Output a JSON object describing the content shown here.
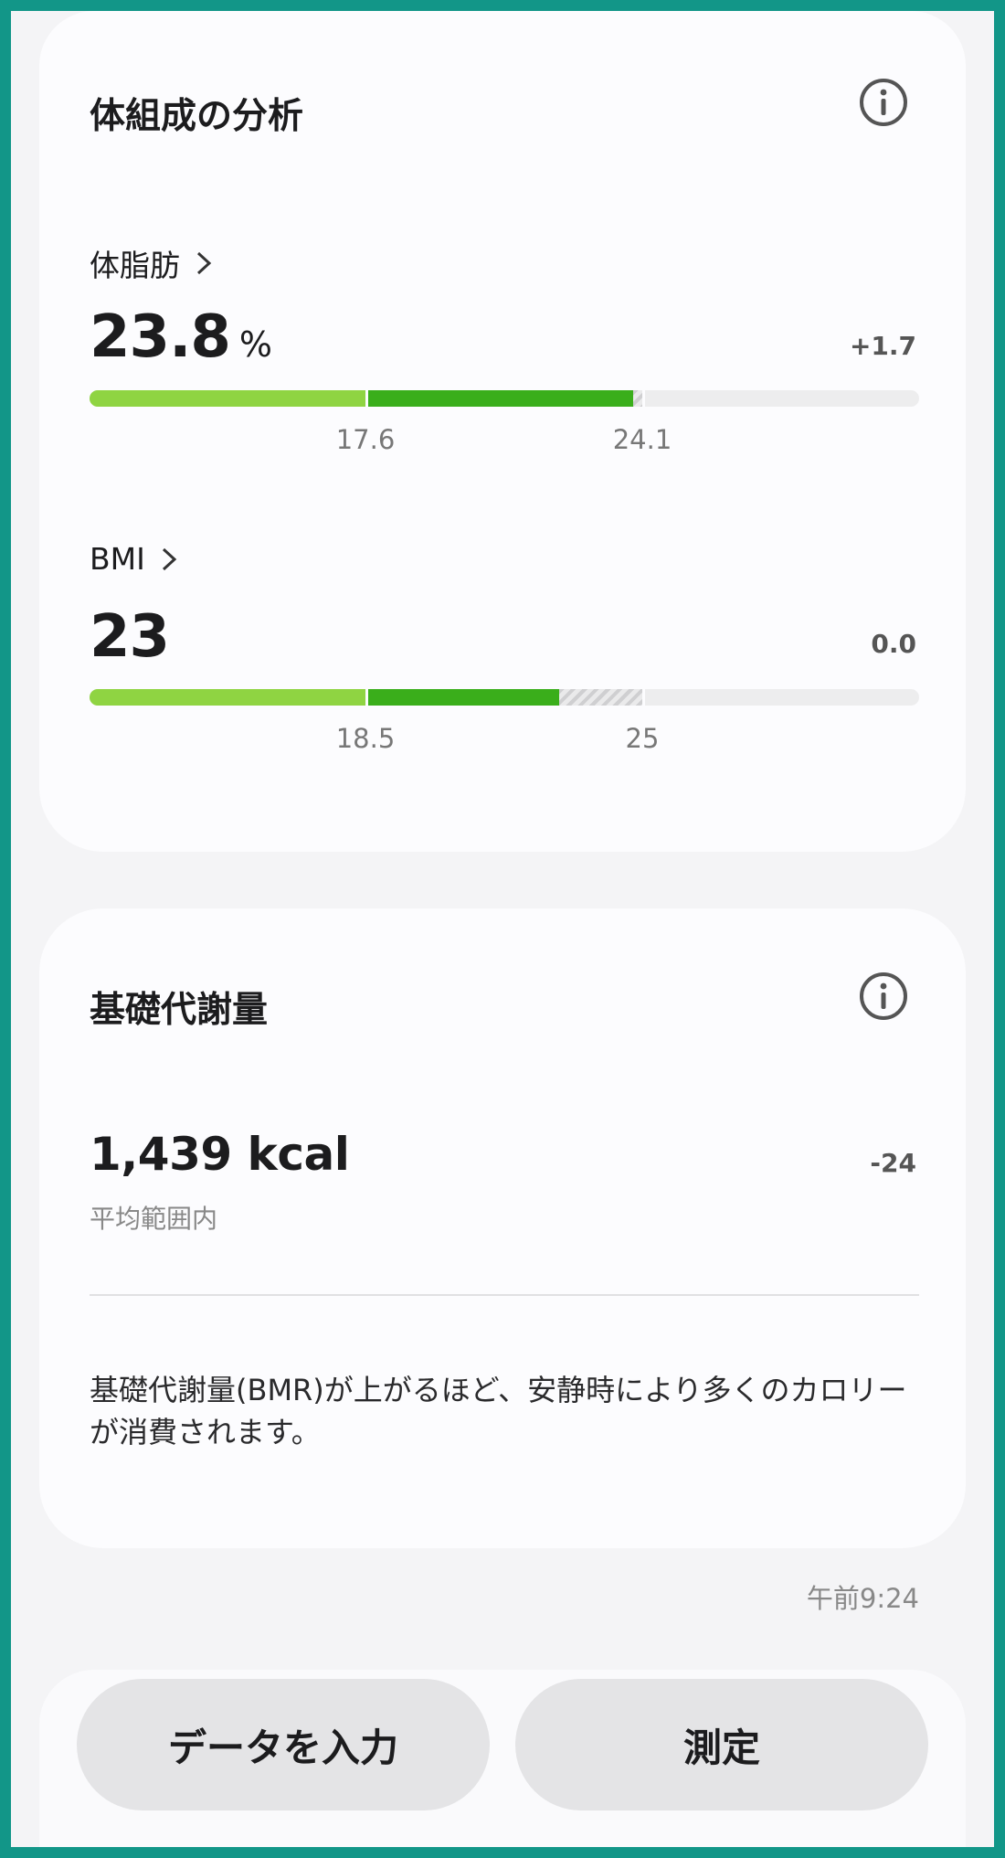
{
  "body_comp": {
    "title": "体組成の分析",
    "body_fat": {
      "label": "体脂肪",
      "value": "23.8",
      "unit": "%",
      "delta": "+1.7",
      "ticks": [
        "17.6",
        "24.1"
      ],
      "bar_fill_fraction": 0.664
    },
    "bmi": {
      "label": "BMI",
      "value": "23",
      "delta": "0.0",
      "ticks": [
        "18.5",
        "25"
      ],
      "bar_fill_fraction": 0.566
    }
  },
  "bmr": {
    "title": "基礎代謝量",
    "value": "1,439 kcal",
    "delta": "-24",
    "status": "平均範囲内",
    "description": "基礎代謝量(BMR)が上がるほど、安静時により多くのカロリーが消費されます。"
  },
  "timestamp": "午前9:24",
  "buttons": {
    "enter_data": "データを入力",
    "measure": "測定"
  },
  "colors": {
    "range_low": "#8fd442",
    "range_normal": "#3aae1b",
    "track": "#ededee",
    "frame": "#129688"
  }
}
